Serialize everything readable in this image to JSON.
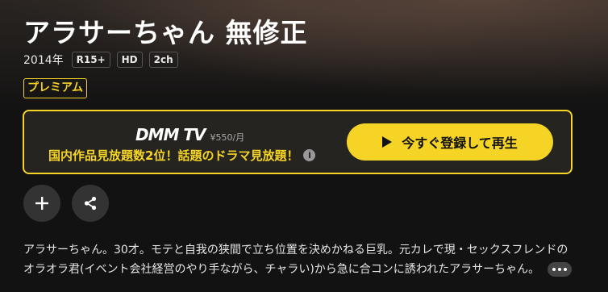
{
  "title": "アラサーちゃん 無修正",
  "meta": {
    "year": "2014年",
    "tags": [
      "R15+",
      "HD",
      "2ch"
    ]
  },
  "badge": "プレミアム",
  "promo": {
    "logo": "DMM TV",
    "price": "¥550/月",
    "text": "国内作品見放題数2位！話題のドラマ見放題！",
    "info_icon": "info-icon",
    "cta_label": "今すぐ登録して再生",
    "cta_icon": "play-icon"
  },
  "actions": [
    {
      "name": "add-to-list-button",
      "icon": "plus-icon"
    },
    {
      "name": "share-button",
      "icon": "share-icon"
    }
  ],
  "description": {
    "line1": "アラサーちゃん。30才。モテと自我の狭間で立ち位置を決めかねる巨乳。元カレで現・セックスフレンドの",
    "line2": "オラオラ君(イベント会社経営のやり手ながら、チャラい)から急に合コンに誘われたアラサーちゃん。"
  },
  "colors": {
    "accent": "#f5d426",
    "background": "#121212"
  }
}
